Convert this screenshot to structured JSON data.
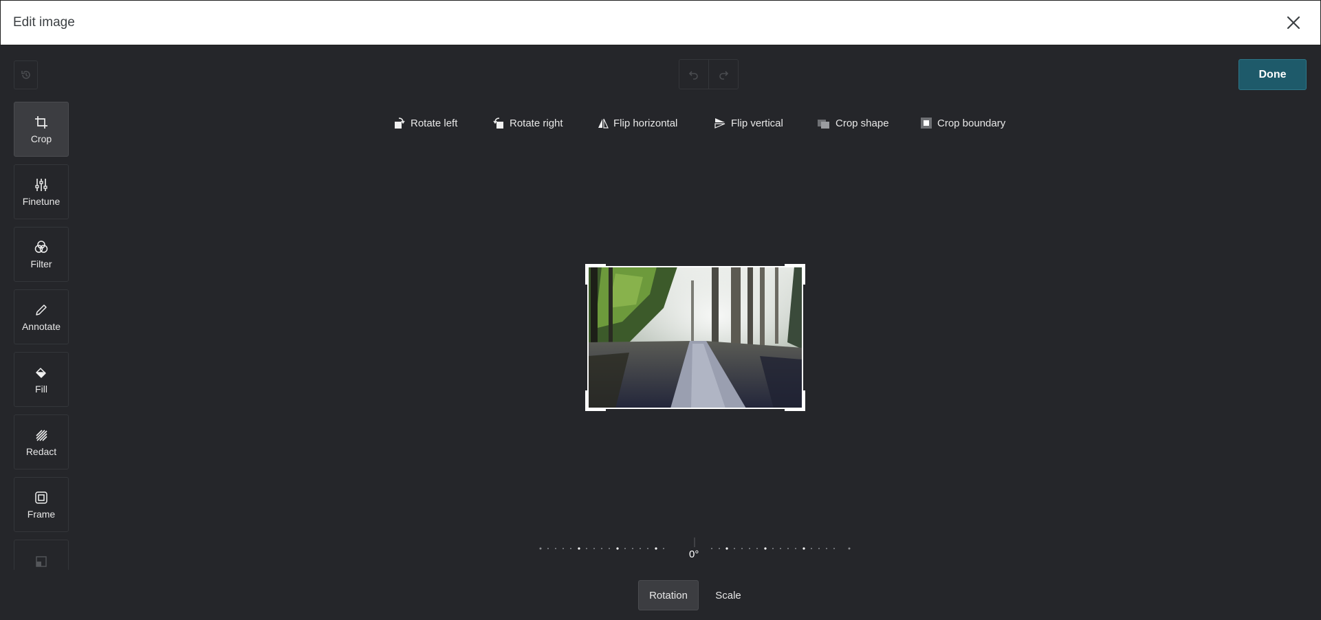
{
  "header": {
    "title": "Edit image"
  },
  "toolbar": {
    "done_label": "Done"
  },
  "tools": [
    {
      "label": "Crop",
      "icon": "crop-icon",
      "active": true
    },
    {
      "label": "Finetune",
      "icon": "sliders-icon"
    },
    {
      "label": "Filter",
      "icon": "filter-icon"
    },
    {
      "label": "Annotate",
      "icon": "pencil-icon"
    },
    {
      "label": "Fill",
      "icon": "fill-bucket-icon"
    },
    {
      "label": "Redact",
      "icon": "redact-icon"
    },
    {
      "label": "Frame",
      "icon": "frame-icon"
    }
  ],
  "crop_actions": [
    {
      "label": "Rotate left",
      "icon": "rotate-left-icon"
    },
    {
      "label": "Rotate right",
      "icon": "rotate-right-icon"
    },
    {
      "label": "Flip horizontal",
      "icon": "flip-horizontal-icon"
    },
    {
      "label": "Flip vertical",
      "icon": "flip-vertical-icon"
    },
    {
      "label": "Crop shape",
      "icon": "crop-shape-icon"
    },
    {
      "label": "Crop boundary",
      "icon": "crop-boundary-icon"
    }
  ],
  "rotation": {
    "value": "0°"
  },
  "modes": [
    {
      "label": "Rotation",
      "active": true
    },
    {
      "label": "Scale"
    }
  ],
  "colors": {
    "accent": "#1e5a6a",
    "background": "#25262a",
    "header": "#ffffff"
  }
}
